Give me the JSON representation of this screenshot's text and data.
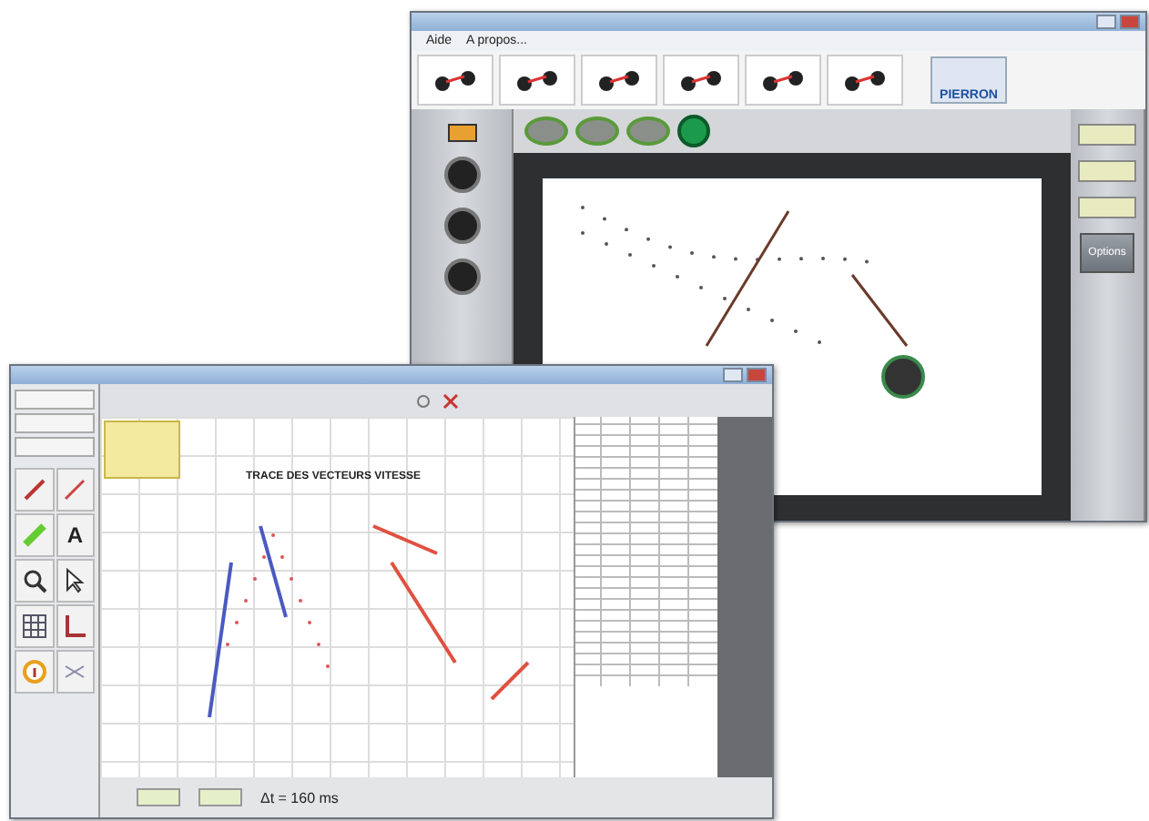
{
  "back_window": {
    "menu": [
      "Aide",
      "A propos..."
    ],
    "logo": "PIERRON",
    "options_button": "Options"
  },
  "front_window": {
    "text_tool": "A",
    "chart_title": "TRACE DES VECTEURS VITESSE",
    "delta_t": "Δt = 160 ms"
  }
}
